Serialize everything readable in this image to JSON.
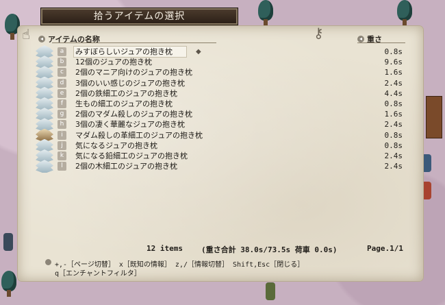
{
  "window_title": "拾うアイテムの選択",
  "columns": {
    "name": "アイテムの名称",
    "weight": "重さ"
  },
  "items": [
    {
      "key": "a",
      "name": "みすぼらしいジュアの抱き枕",
      "weight": "0.8s"
    },
    {
      "key": "b",
      "name": "12個のジュアの抱き枕",
      "weight": "9.6s"
    },
    {
      "key": "c",
      "name": "2個のマニア向けのジュアの抱き枕",
      "weight": "1.6s"
    },
    {
      "key": "d",
      "name": "3個のいい感じのジュアの抱き枕",
      "weight": "2.4s"
    },
    {
      "key": "e",
      "name": "2個の鉄細工のジュアの抱き枕",
      "weight": "4.4s"
    },
    {
      "key": "f",
      "name": "生もの細工のジュアの抱き枕",
      "weight": "0.8s"
    },
    {
      "key": "g",
      "name": "2個のマダム殺しのジュアの抱き枕",
      "weight": "1.6s"
    },
    {
      "key": "h",
      "name": "3個の凄く華麗なジュアの抱き枕",
      "weight": "2.4s"
    },
    {
      "key": "i",
      "name": "マダム殺しの革細工のジュアの抱き枕",
      "weight": "0.8s"
    },
    {
      "key": "j",
      "name": "気になるジュアの抱き枕",
      "weight": "0.8s"
    },
    {
      "key": "k",
      "name": "気になる鉛細工のジュアの抱き枕",
      "weight": "2.4s"
    },
    {
      "key": "l",
      "name": "2個の木細工のジュアの抱き枕",
      "weight": "2.4s"
    }
  ],
  "selected_index": 0,
  "status": {
    "count": "12 items",
    "totals": "(重さ合計 38.0s/73.5s  荷車 0.0s)",
    "page": "Page.1/1"
  },
  "help": {
    "line1": "+,-［ページ切替］ x［既知の情報］ z,/［情報切替］ Shift,Esc［閉じる］",
    "line2": "q［エンチャントフィルタ］"
  }
}
